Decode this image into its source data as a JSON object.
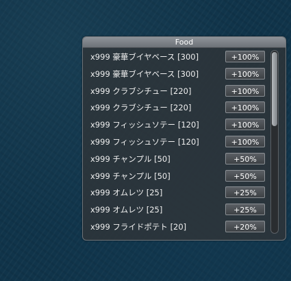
{
  "panel": {
    "title": "Food",
    "items": [
      {
        "label": "x999 豪華ブイヤベース [300]",
        "bonus": "+100%"
      },
      {
        "label": "x999 豪華ブイヤベース [300]",
        "bonus": "+100%"
      },
      {
        "label": "x999 クラブシチュー [220]",
        "bonus": "+100%"
      },
      {
        "label": "x999 クラブシチュー [220]",
        "bonus": "+100%"
      },
      {
        "label": "x999 フィッシュソテー [120]",
        "bonus": "+100%"
      },
      {
        "label": "x999 フィッシュソテー [120]",
        "bonus": "+100%"
      },
      {
        "label": "x999 チャンプル [50]",
        "bonus": "+50%"
      },
      {
        "label": "x999 チャンプル [50]",
        "bonus": "+50%"
      },
      {
        "label": "x999 オムレツ [25]",
        "bonus": "+25%"
      },
      {
        "label": "x999 オムレツ [25]",
        "bonus": "+25%"
      },
      {
        "label": "x999 フライドポテト [20]",
        "bonus": "+20%"
      }
    ]
  }
}
